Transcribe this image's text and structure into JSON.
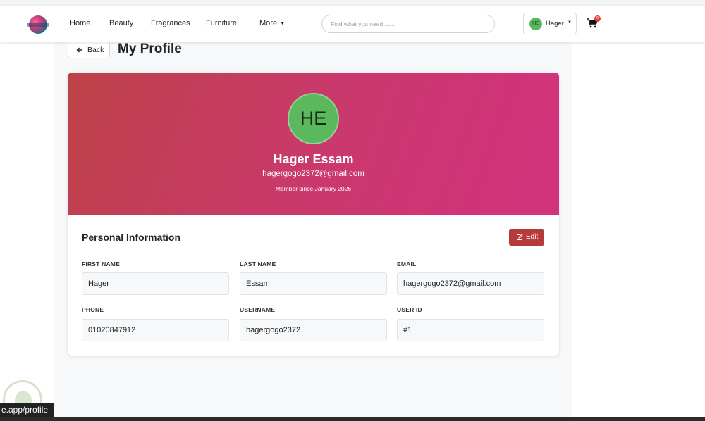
{
  "nav": {
    "links": [
      "Home",
      "Beauty",
      "Fragrances",
      "Furniture"
    ],
    "more_label": "More",
    "search_placeholder": "Find what you need ......",
    "user": {
      "initials": "HE",
      "name": "Hager"
    },
    "cart_count": "0"
  },
  "page": {
    "back_label": "Back",
    "title": "My Profile"
  },
  "profile": {
    "initials": "HE",
    "full_name": "Hager Essam",
    "email": "hagergogo2372@gmail.com",
    "member_since": "Member since January 2026"
  },
  "personal_info": {
    "title": "Personal Information",
    "edit_label": "Edit",
    "fields": {
      "first_name": {
        "label": "FIRST NAME",
        "value": "Hager"
      },
      "last_name": {
        "label": "LAST NAME",
        "value": "Essam"
      },
      "email": {
        "label": "EMAIL",
        "value": "hagergogo2372@gmail.com"
      },
      "phone": {
        "label": "PHONE",
        "value": "01020847912"
      },
      "username": {
        "label": "USERNAME",
        "value": "hagergogo2372"
      },
      "user_id": {
        "label": "USER ID",
        "value": "#1"
      }
    }
  },
  "status_url": "e.app/profile",
  "colors": {
    "hero_start": "#bd4248",
    "hero_end": "#d4327e",
    "avatar": "#5cb85c",
    "edit_button": "#b73a3a",
    "cart_badge": "#e53935"
  }
}
